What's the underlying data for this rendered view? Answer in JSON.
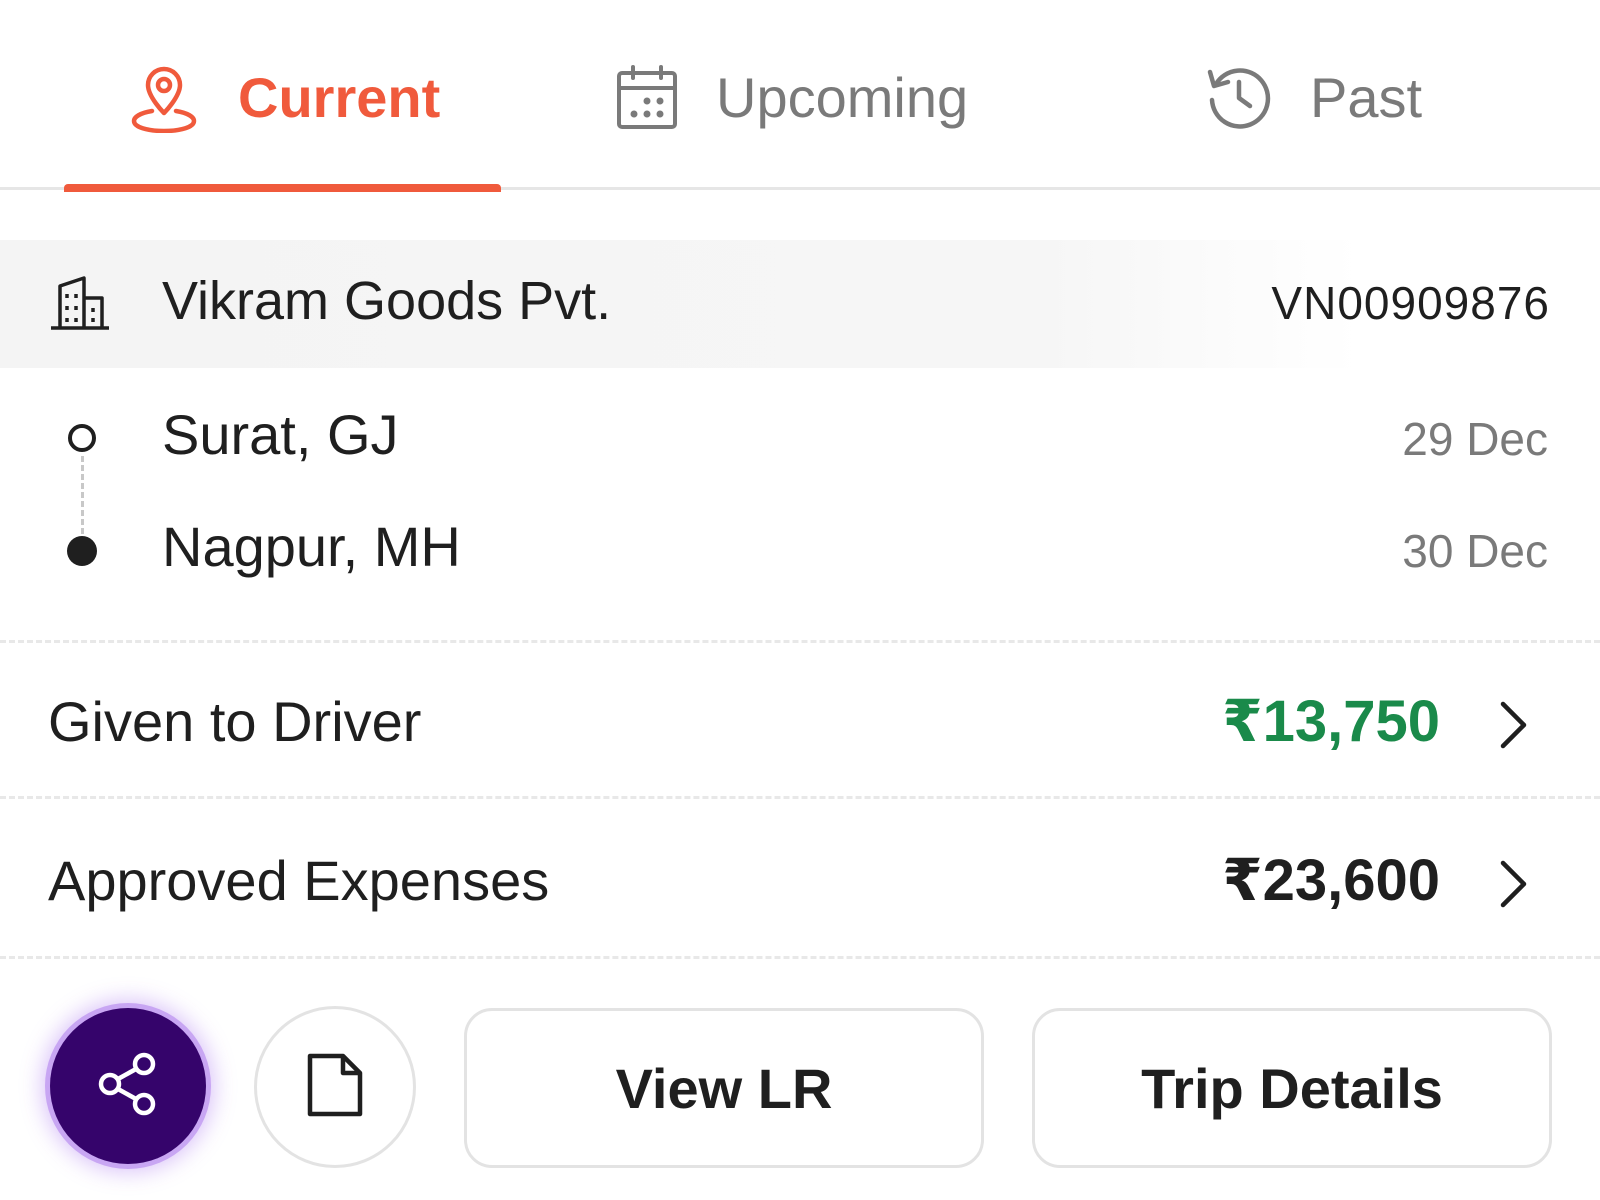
{
  "tabs": [
    {
      "label": "Current",
      "icon": "location-pin-icon",
      "active": true
    },
    {
      "label": "Upcoming",
      "icon": "calendar-icon",
      "active": false
    },
    {
      "label": "Past",
      "icon": "history-icon",
      "active": false
    }
  ],
  "colors": {
    "accent": "#f05a3c",
    "inactive_tab": "#7a7a7a",
    "positive_amount": "#1a8a4a",
    "share_button": "#35046b"
  },
  "trip": {
    "company": {
      "name": "Vikram Goods Pvt.",
      "code": "VN00909876",
      "icon": "building-icon"
    },
    "route": {
      "from": {
        "place": "Surat, GJ",
        "date": "29 Dec"
      },
      "to": {
        "place": "Nagpur, MH",
        "date": "30 Dec"
      }
    },
    "given_to_driver": {
      "label": "Given to Driver",
      "amount": "₹13,750"
    },
    "approved_expenses": {
      "label": "Approved Expenses",
      "amount": "₹23,600"
    }
  },
  "actions": {
    "share_icon": "share-icon",
    "document_icon": "document-icon",
    "view_lr": "View LR",
    "trip_details": "Trip Details"
  }
}
